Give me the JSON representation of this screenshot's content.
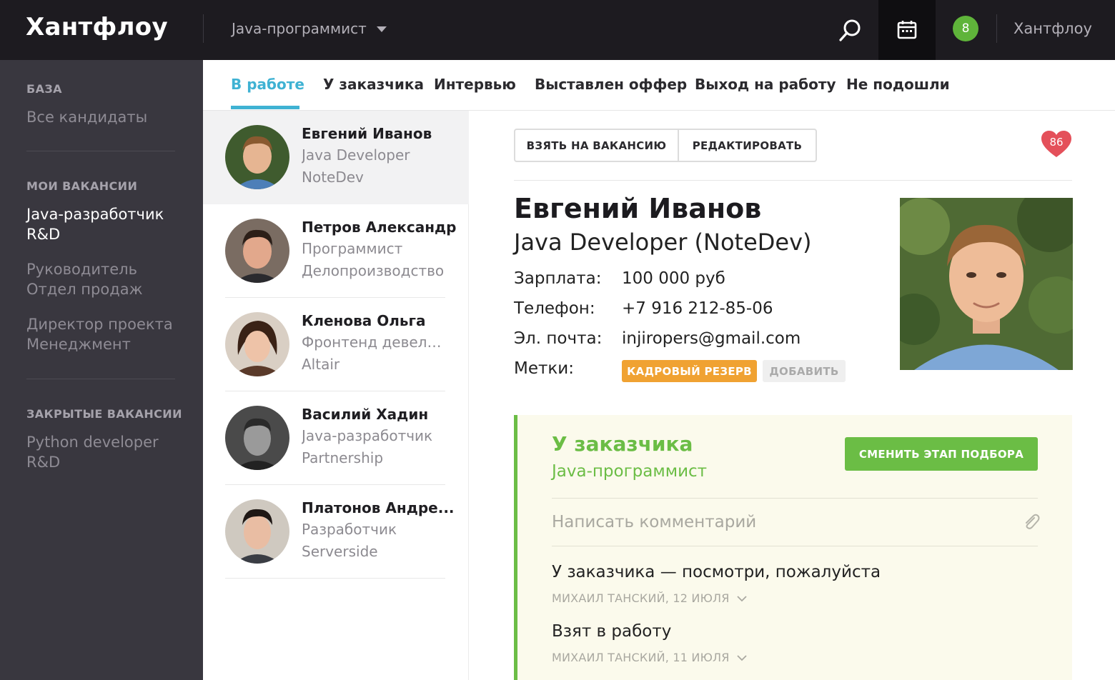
{
  "app": {
    "logo": "Хантфлоу",
    "vacancy_selector": "Java-программист",
    "notification_count": "8",
    "account_name": "Хантфлоу"
  },
  "sidebar": {
    "sections": [
      {
        "heading": "БАЗА",
        "items": [
          {
            "line1": "Все кандидаты",
            "line2": ""
          }
        ]
      },
      {
        "heading": "МОИ ВАКАНСИИ",
        "items": [
          {
            "line1": "Java-разработчик",
            "line2": "R&D"
          },
          {
            "line1": "Руководитель",
            "line2": "Отдел продаж"
          },
          {
            "line1": "Директор проекта",
            "line2": "Менеджмент"
          }
        ]
      },
      {
        "heading": "ЗАКРЫТЫЕ ВАКАНСИИ",
        "items": [
          {
            "line1": "Python developer",
            "line2": "R&D"
          }
        ]
      }
    ]
  },
  "tabs": [
    "В работе",
    "У заказчика",
    "Интервью",
    "Выставлен оффер",
    "Выход на работу",
    "Не подошли"
  ],
  "candidates": [
    {
      "name": "Евгений Иванов",
      "position": "Java Developer",
      "company": "NoteDev"
    },
    {
      "name": "Петров Александр",
      "position": "Программист",
      "company": "Делопроизводство"
    },
    {
      "name": "Кленова Ольга",
      "position": "Фронтенд девело...",
      "company": "Altair"
    },
    {
      "name": "Василий Хадин",
      "position": "Java-разработчик",
      "company": "Partnership"
    },
    {
      "name": "Платонов Андре...",
      "position": "Разработчик",
      "company": "Serverside"
    }
  ],
  "detail": {
    "take_button": "ВЗЯТЬ НА ВАКАНСИЮ",
    "edit_button": "РЕДАКТИРОВАТЬ",
    "score": "86",
    "name": "Евгений Иванов",
    "title": "Java Developer (NoteDev)",
    "fields": {
      "salary_label": "Зарплата:",
      "salary": "100 000 руб",
      "phone_label": "Телефон:",
      "phone": "+7 916 212-85-06",
      "email_label": "Эл. почта:",
      "email": "injiropers@gmail.com",
      "tags_label": "Метки:"
    },
    "tags": [
      "КАДРОВЫЙ РЕЗЕРВ"
    ],
    "add_tag": "ДОБАВИТЬ"
  },
  "stage": {
    "title": "У заказчика",
    "vacancy": "Java-программист",
    "change_button": "СМЕНИТЬ ЭТАП ПОДБОРА",
    "comment_placeholder": "Написать комментарий",
    "events": [
      {
        "text": "У заказчика — посмотри, пожалуйста",
        "meta": "МИХАИЛ ТАНСКИЙ, 12 ИЮЛЯ"
      },
      {
        "text": "Взят в работу",
        "meta": "МИХАИЛ ТАНСКИЙ, 11 ИЮЛЯ"
      }
    ]
  },
  "colors": {
    "accent": "#3fb2d3",
    "green": "#6bbd45",
    "orange": "#f0a232",
    "heart": "#e4505a",
    "topbar": "#1d1b20",
    "sidebar": "#39373f"
  },
  "icons": {
    "search": "search-icon",
    "calendar": "calendar-icon",
    "attach": "paperclip-icon",
    "chevron": "chevron-down-icon",
    "heart": "heart-icon"
  }
}
